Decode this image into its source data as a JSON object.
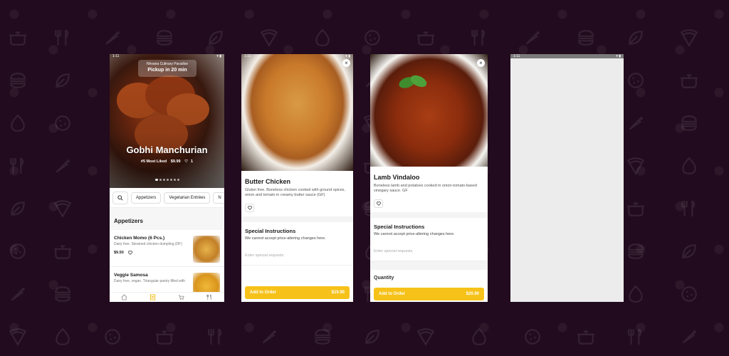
{
  "screen1": {
    "status_time": "1:11",
    "restaurant": "Nirvana Culinary Paradise",
    "pickup": "Pickup in 20 min",
    "featured_name": "Gobhi Manchurian",
    "featured_badge": "#5 Most Liked",
    "featured_price": "$9.99",
    "featured_likes": "1",
    "tabs": [
      "Appetizers",
      "Vegetarian Entrées",
      "N"
    ],
    "section_title": "Appetizers",
    "items": [
      {
        "name": "Chicken Momo (6 Pcs.)",
        "desc": "Dairy free. Steamed chicken dumpling (DF)",
        "price": "$9.50"
      },
      {
        "name": "Veggie Samosa",
        "desc": "Dairy free, vegan. Triangular pastry filled with",
        "price": ""
      }
    ]
  },
  "screen2": {
    "status_time": "1:11",
    "close": "×",
    "title": "Butter Chicken",
    "desc": "Gluten free. Boneless chicken cooked with ground spices, onion and tomato in creamy butter sauce (GF)",
    "special_title": "Special Instructions",
    "special_note": "We cannot accept price-altering changes here.",
    "placeholder": "Enter special requests",
    "add_label": "Add to Order",
    "add_price": "$19.90"
  },
  "screen3": {
    "close": "×",
    "title": "Lamb Vindaloo",
    "desc": "Boneless lamb and potatoes cooked in onion-tomato-based vinegary sauce. GF",
    "special_title": "Special Instructions",
    "special_note": "We cannot accept price-altering changes here.",
    "placeholder": "Enter special requests",
    "quantity_label": "Quantity",
    "add_label": "Add to Order",
    "add_price": "$20.90"
  },
  "screen4": {
    "status_time": "1:11"
  },
  "colors": {
    "background": "#220b1e",
    "accent": "#f6c21a"
  }
}
